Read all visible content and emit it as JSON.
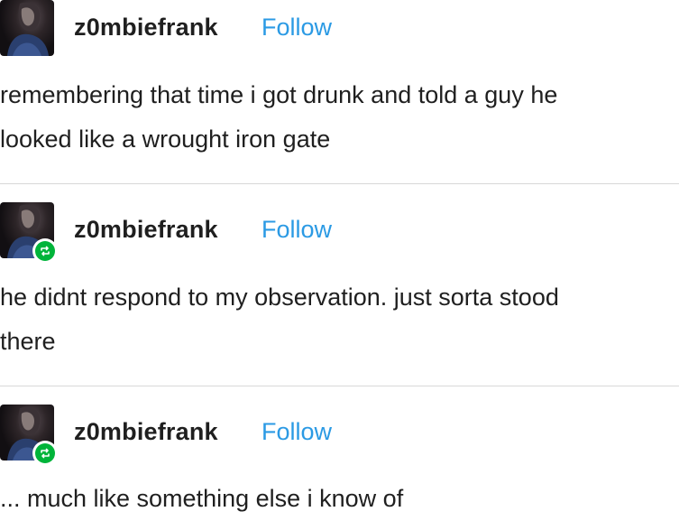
{
  "posts": [
    {
      "username": "z0mbiefrank",
      "follow_label": "Follow",
      "reblogged": false,
      "lines": [
        "remembering that time i got drunk and told a guy he",
        "looked like a wrought iron gate"
      ]
    },
    {
      "username": "z0mbiefrank",
      "follow_label": "Follow",
      "reblogged": true,
      "lines": [
        "he didnt respond to my observation. just sorta stood",
        "there"
      ]
    },
    {
      "username": "z0mbiefrank",
      "follow_label": "Follow",
      "reblogged": true,
      "lines": [
        "... much like something else i know of"
      ]
    }
  ],
  "colors": {
    "follow": "#2b9ae4",
    "reblog_badge": "#00b43a",
    "divider": "#d8d8d8"
  },
  "icons": {
    "avatar": "avatar-photo",
    "reblog": "reblog-icon"
  }
}
